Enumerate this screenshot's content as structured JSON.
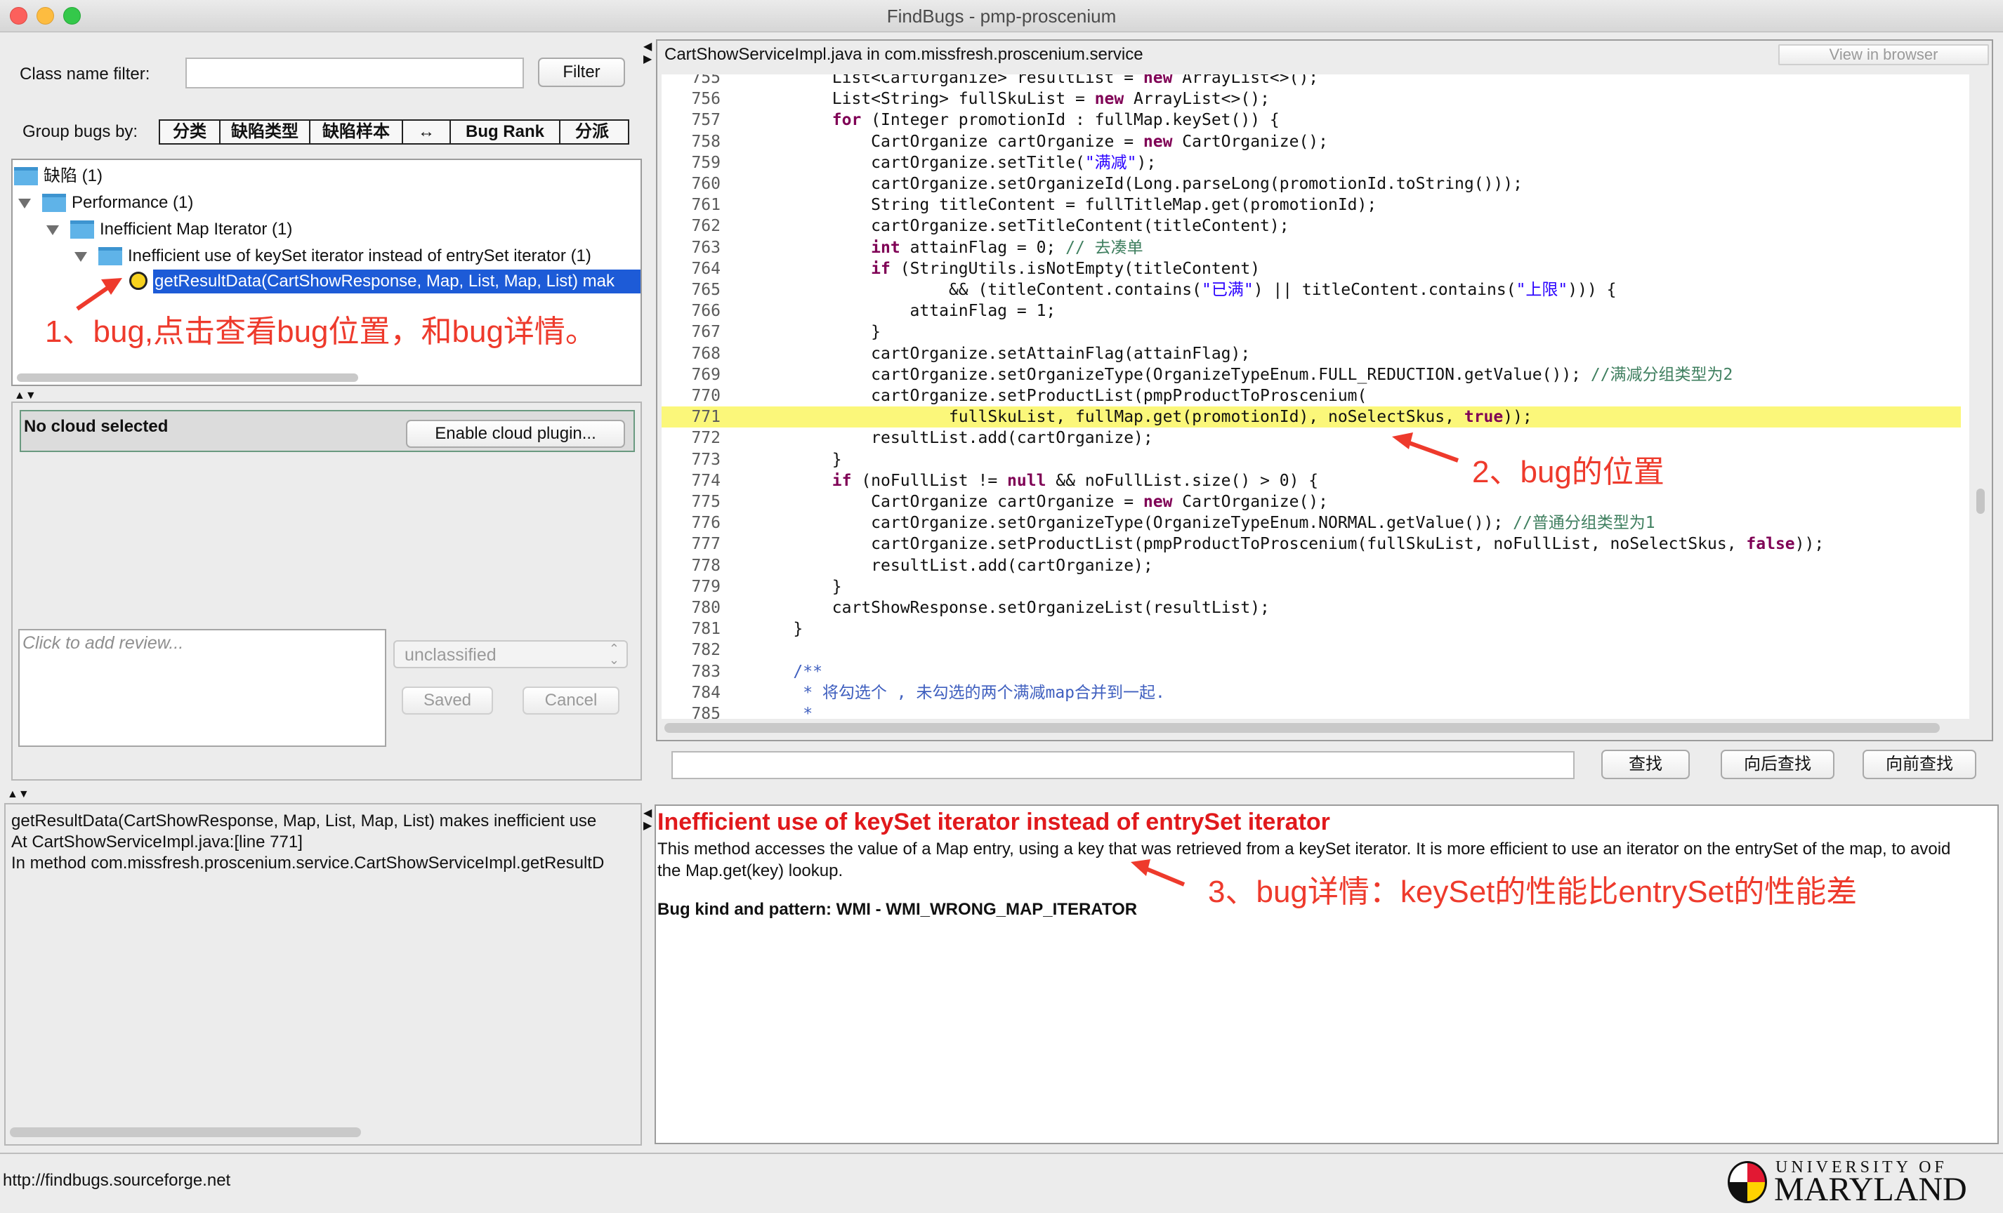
{
  "window": {
    "title": "FindBugs - pmp-proscenium"
  },
  "filter": {
    "label": "Class name filter:",
    "value": "",
    "button": "Filter"
  },
  "group": {
    "label": "Group bugs by:",
    "buttons": [
      "分类",
      "缺陷类型",
      "缺陷样本",
      "↔",
      "Bug Rank",
      "分派"
    ]
  },
  "tree": {
    "root": "缺陷 (1)",
    "category": "Performance (1)",
    "type": "Inefficient Map Iterator (1)",
    "pattern": "Inefficient use of keySet iterator instead of entrySet iterator (1)",
    "bug": "getResultData(CartShowResponse, Map, List, Map, List) mak"
  },
  "cloud": {
    "status": "No cloud selected",
    "button": "Enable cloud plugin..."
  },
  "review": {
    "placeholder": "Click to add review...",
    "classification": "unclassified",
    "saved": "Saved",
    "cancel": "Cancel"
  },
  "summary": {
    "lines": [
      "getResultData(CartShowResponse, Map, List, Map, List) makes inefficient use",
      "At CartShowServiceImpl.java:[line 771]",
      "In method com.missfresh.proscenium.service.CartShowServiceImpl.getResultD"
    ]
  },
  "source": {
    "header": "CartShowServiceImpl.java in com.missfresh.proscenium.service",
    "view_button": "View in browser",
    "highlight_line": "771",
    "lines": [
      {
        "n": "755",
        "code": "        List<CartOrganize> resultList = new ArrayList<>();"
      },
      {
        "n": "756",
        "code": "        List<String> fullSkuList = new ArrayList<>();"
      },
      {
        "n": "757",
        "code": "        for (Integer promotionId : fullMap.keySet()) {"
      },
      {
        "n": "758",
        "code": "            CartOrganize cartOrganize = new CartOrganize();"
      },
      {
        "n": "759",
        "code": "            cartOrganize.setTitle(\"满减\");"
      },
      {
        "n": "760",
        "code": "            cartOrganize.setOrganizeId(Long.parseLong(promotionId.toString()));"
      },
      {
        "n": "761",
        "code": "            String titleContent = fullTitleMap.get(promotionId);"
      },
      {
        "n": "762",
        "code": "            cartOrganize.setTitleContent(titleContent);"
      },
      {
        "n": "763",
        "code": "            int attainFlag = 0; // 去凑单"
      },
      {
        "n": "764",
        "code": "            if (StringUtils.isNotEmpty(titleContent)"
      },
      {
        "n": "765",
        "code": "                    && (titleContent.contains(\"已满\") || titleContent.contains(\"上限\"))) {"
      },
      {
        "n": "766",
        "code": "                attainFlag = 1;"
      },
      {
        "n": "767",
        "code": "            }"
      },
      {
        "n": "768",
        "code": "            cartOrganize.setAttainFlag(attainFlag);"
      },
      {
        "n": "769",
        "code": "            cartOrganize.setOrganizeType(OrganizeTypeEnum.FULL_REDUCTION.getValue()); //满减分组类型为2"
      },
      {
        "n": "770",
        "code": "            cartOrganize.setProductList(pmpProductToProscenium("
      },
      {
        "n": "771",
        "code": "                    fullSkuList, fullMap.get(promotionId), noSelectSkus, true));"
      },
      {
        "n": "772",
        "code": "            resultList.add(cartOrganize);"
      },
      {
        "n": "773",
        "code": "        }"
      },
      {
        "n": "774",
        "code": "        if (noFullList != null && noFullList.size() > 0) {"
      },
      {
        "n": "775",
        "code": "            CartOrganize cartOrganize = new CartOrganize();"
      },
      {
        "n": "776",
        "code": "            cartOrganize.setOrganizeType(OrganizeTypeEnum.NORMAL.getValue()); //普通分组类型为1"
      },
      {
        "n": "777",
        "code": "            cartOrganize.setProductList(pmpProductToProscenium(fullSkuList, noFullList, noSelectSkus, false));"
      },
      {
        "n": "778",
        "code": "            resultList.add(cartOrganize);"
      },
      {
        "n": "779",
        "code": "        }"
      },
      {
        "n": "780",
        "code": "        cartShowResponse.setOrganizeList(resultList);"
      },
      {
        "n": "781",
        "code": "    }"
      },
      {
        "n": "782",
        "code": ""
      },
      {
        "n": "783",
        "code": "    /**"
      },
      {
        "n": "784",
        "code": "     * 将勾选个 , 未勾选的两个满减map合并到一起."
      },
      {
        "n": "785",
        "code": "     *"
      }
    ]
  },
  "find": {
    "value": "",
    "find": "查找",
    "next": "向后查找",
    "prev": "向前查找"
  },
  "details": {
    "title": "Inefficient use of keySet iterator instead of entrySet iterator",
    "body": "This method accesses the value of a Map entry, using a key that was retrieved from a keySet iterator. It is more efficient to use an iterator on the entrySet of the map, to avoid the Map.get(key) lookup.",
    "kind": "Bug kind and pattern: WMI - WMI_WRONG_MAP_ITERATOR"
  },
  "annotations": {
    "a1": "1、bug,点击查看bug位置，和bug详情。",
    "a2": "2、bug的位置",
    "a3": "3、bug详情：keySet的性能比entrySet的性能差"
  },
  "status": {
    "url": "http://findbugs.sourceforge.net"
  },
  "logo": {
    "line1": "UNIVERSITY OF",
    "line2": "MARYLAND"
  },
  "colors": {
    "annotation": "#ee3a2c",
    "selection": "#1d5bd7",
    "highlight": "#fbf77a",
    "detail_title": "#e1191c"
  }
}
